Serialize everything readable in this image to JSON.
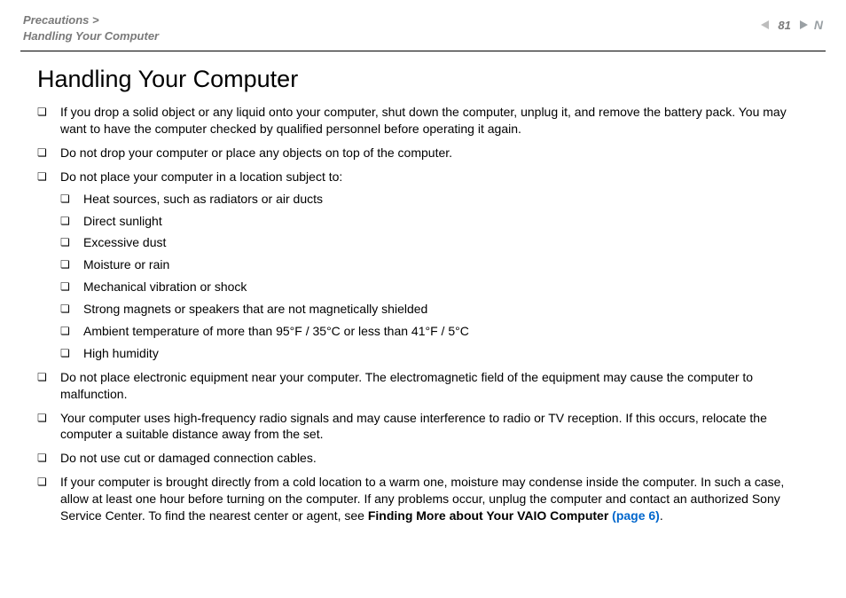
{
  "header": {
    "breadcrumb_line1": "Precautions >",
    "breadcrumb_line2": "Handling Your Computer",
    "page_number": "81",
    "n_mark": "N"
  },
  "main": {
    "title": "Handling Your Computer",
    "bullets": [
      {
        "text": "If you drop a solid object or any liquid onto your computer, shut down the computer, unplug it, and remove the battery pack. You may want to have the computer checked by qualified personnel before operating it again."
      },
      {
        "text": "Do not drop your computer or place any objects on top of the computer."
      },
      {
        "text": "Do not place your computer in a location subject to:",
        "sub": [
          "Heat sources, such as radiators or air ducts",
          "Direct sunlight",
          "Excessive dust",
          "Moisture or rain",
          "Mechanical vibration or shock",
          "Strong magnets or speakers that are not magnetically shielded",
          "Ambient temperature of more than 95°F / 35°C or less than 41°F / 5°C",
          "High humidity"
        ]
      },
      {
        "text": "Do not place electronic equipment near your computer. The electromagnetic field of the equipment may cause the computer to malfunction."
      },
      {
        "text": "Your computer uses high-frequency radio signals and may cause interference to radio or TV reception. If this occurs, relocate the computer a suitable distance away from the set."
      },
      {
        "text": "Do not use cut or damaged connection cables."
      },
      {
        "text_pre": "If your computer is brought directly from a cold location to a warm one, moisture may condense inside the computer. In such a case, allow at least one hour before turning on the computer. If any problems occur, unplug the computer and contact an authorized Sony Service Center. To find the nearest center or agent, see ",
        "bold": "Finding More about Your VAIO Computer ",
        "link_text": "(page 6)",
        "tail": "."
      }
    ]
  }
}
